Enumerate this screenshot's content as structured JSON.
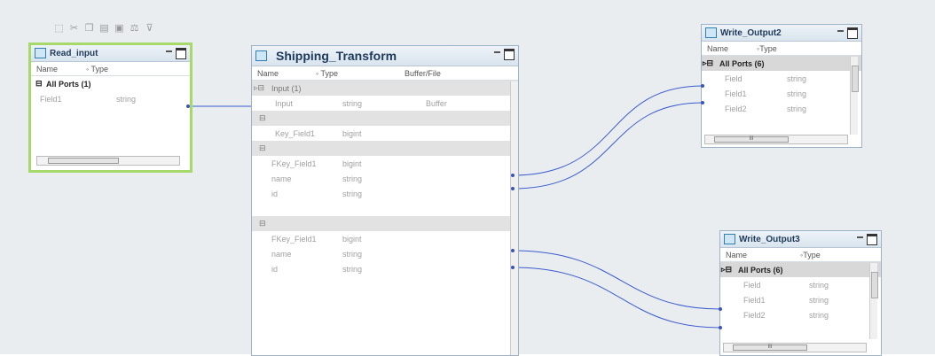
{
  "read_input": {
    "title": "Read_input",
    "col_name": "Name",
    "col_type": "Type",
    "group": "All Ports (1)",
    "fields": [
      {
        "name": "Field1",
        "type": "string"
      }
    ]
  },
  "shipping": {
    "title": "Shipping_Transform",
    "col_name": "Name",
    "col_type": "Type",
    "col_buffer": "Buffer/File",
    "input_group": "Input (1)",
    "input_field": {
      "name": "Input",
      "type": "string",
      "buffer": "Buffer"
    },
    "group2_field": {
      "name": "Key_Field1",
      "type": "bigint"
    },
    "group3_fields": [
      {
        "name": "FKey_Field1",
        "type": "bigint"
      },
      {
        "name": "name",
        "type": "string"
      },
      {
        "name": "id",
        "type": "string"
      }
    ],
    "group4_fields": [
      {
        "name": "FKey_Field1",
        "type": "bigint"
      },
      {
        "name": "name",
        "type": "string"
      },
      {
        "name": "id",
        "type": "string"
      }
    ]
  },
  "write2": {
    "title": "Write_Output2",
    "col_name": "Name",
    "col_type": "Type",
    "group": "All Ports (6)",
    "fields": [
      {
        "name": "Field",
        "type": "string"
      },
      {
        "name": "Field1",
        "type": "string"
      },
      {
        "name": "Field2",
        "type": "string"
      }
    ],
    "scroll_mark": "III"
  },
  "write3": {
    "title": "Write_Output3",
    "col_name": "Name",
    "col_type": "Type",
    "group": "All Ports (6)",
    "fields": [
      {
        "name": "Field",
        "type": "string"
      },
      {
        "name": "Field1",
        "type": "string"
      },
      {
        "name": "Field2",
        "type": "string"
      }
    ],
    "scroll_mark": "III"
  },
  "read_scroll_mark": "III",
  "toolbar_icons": [
    "new-object-icon",
    "cut-icon",
    "copy-icon",
    "paste-icon",
    "delete-icon",
    "format-icon",
    "filter-icon"
  ],
  "colors": {
    "link": "#3b5bd0",
    "selected_border": "#a6d96a",
    "canvas": "#e9edf0"
  }
}
